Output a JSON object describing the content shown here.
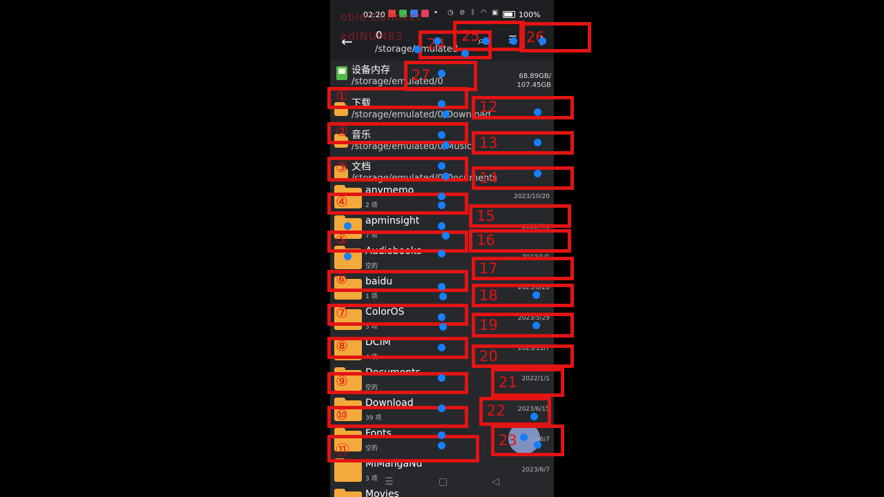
{
  "status_bar": {
    "time": "02:20",
    "battery": "100%",
    "icons": [
      "alarm-icon",
      "mute-icon",
      "bluetooth-icon",
      "wifi-icon",
      "sim-icon"
    ],
    "dot": "•"
  },
  "app_bar": {
    "item_count": "0",
    "path": "/storage/emulated",
    "icons": [
      "back-icon",
      "search-icon",
      "list-view-icon",
      "more-icon"
    ]
  },
  "storage": {
    "name": "设备内存",
    "path": "/storage/emulated/0",
    "used": "68.89GB/",
    "total": "107.45GB"
  },
  "shortcuts": [
    {
      "name": "下载",
      "path": "/storage/emulated/0/Download"
    },
    {
      "name": "音乐",
      "path": "/storage/emulated/0/Music"
    },
    {
      "name": "文档",
      "path": "/storage/emulated/0/Documents"
    }
  ],
  "folders": [
    {
      "name": "anymemo",
      "meta": "2 项",
      "date": "2023/10/20"
    },
    {
      "name": "apminsight",
      "meta": "7 项",
      "date": "2023/7/6"
    },
    {
      "name": "Audiobooks",
      "meta": "空的",
      "date": "2022/1/1"
    },
    {
      "name": "baidu",
      "meta": "1 项",
      "date": "2023/8/28"
    },
    {
      "name": "ColorOS",
      "meta": "3 项",
      "date": "2023/5/29"
    },
    {
      "name": "DCIM",
      "meta": "4 项",
      "date": "2023/11/7"
    },
    {
      "name": "Documents",
      "meta": "空的",
      "date": "2022/1/1"
    },
    {
      "name": "Download",
      "meta": "39 项",
      "date": "2023/6/15"
    },
    {
      "name": "Fonts",
      "meta": "空的",
      "date": "2023/6/7"
    },
    {
      "name": "MiMangaNu",
      "meta": "3 项",
      "date": "2023/6/7"
    },
    {
      "name": "Movies",
      "meta": "",
      "date": ""
    }
  ],
  "nav_bar": {
    "icons": [
      "menu-icon",
      "home-icon",
      "back-triangle-icon"
    ]
  },
  "watermark": {
    "line1": "oble Connect",
    "line2": "edINUM83"
  },
  "annotations": {
    "numbered": [
      "12",
      "13",
      "14",
      "15",
      "16",
      "17",
      "18",
      "19",
      "20",
      "21",
      "22",
      "23",
      "24",
      "25",
      "26",
      "27"
    ],
    "circled": [
      "①",
      "②",
      "③",
      "④",
      "⑤",
      "⑥",
      "⑦",
      "⑧",
      "⑨",
      "⑩",
      "⑪"
    ]
  },
  "colors": {
    "annotation_red": "#e31414",
    "dot_blue": "#1580f8",
    "folder_orange": "#f4a93b",
    "storage_green": "#55b84a"
  }
}
